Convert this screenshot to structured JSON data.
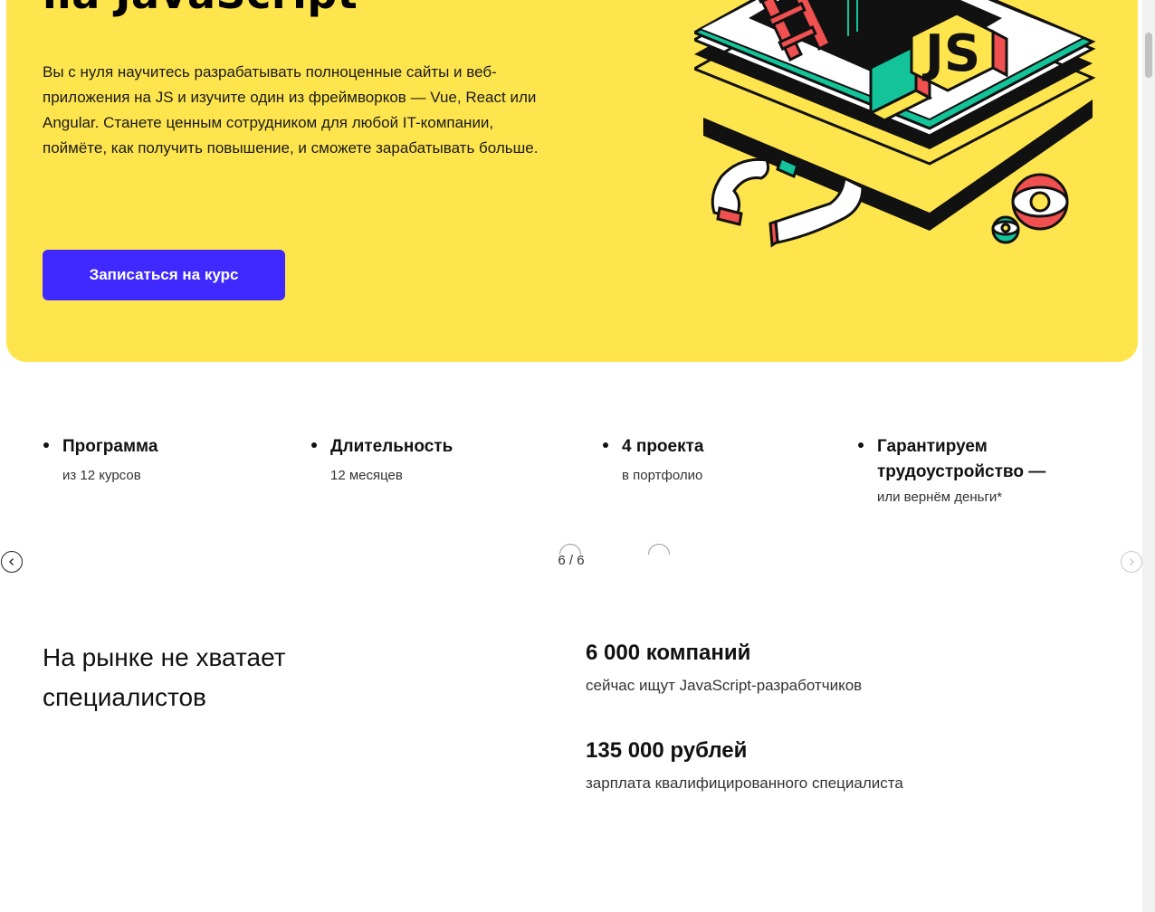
{
  "hero": {
    "title": "на JavaScript",
    "description": "Вы с нуля научитесь разрабатывать полноценные сайты и веб-приложения на JS и изучите один из фреймворков — Vue, React или Angular. Станете ценным сотрудником для любой IT-компании, поймёте, как получить повышение, и сможете зарабатывать больше.",
    "cta_label": "Записаться на курс",
    "illustration_text": "JS",
    "colors": {
      "background": "#fee54e",
      "button": "#4029ff"
    }
  },
  "features": [
    {
      "title": "Программа",
      "subtitle": "из 12 курсов"
    },
    {
      "title": "Длительность",
      "subtitle": "12 месяцев"
    },
    {
      "title": "4 проекта",
      "subtitle": "в портфолио"
    },
    {
      "title": "Гарантируем трудоустройство —",
      "subtitle": "или вернём деньги*"
    }
  ],
  "slider": {
    "counter": "6 / 6",
    "prev_icon": "chevron-left-icon",
    "next_icon": "chevron-right-icon"
  },
  "market": {
    "heading": "На рынке не хватает специалистов",
    "stats": [
      {
        "value": "6 000 компаний",
        "desc": "сейчас ищут JavaScript-разработчиков"
      },
      {
        "value": "135 000 рублей",
        "desc": "зарплата квалифицированного специалиста"
      }
    ]
  }
}
